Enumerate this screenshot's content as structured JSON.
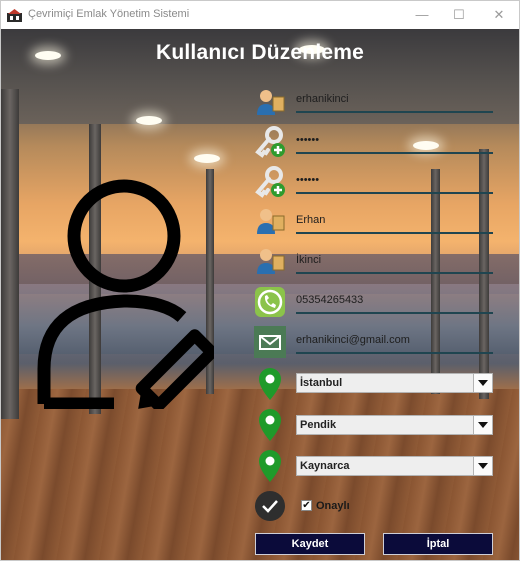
{
  "window": {
    "title": "Çevrimiçi Emlak Yönetim Sistemi",
    "minimize_label": "—",
    "maximize_label": "☐",
    "close_label": "✕"
  },
  "form": {
    "heading": "Kullanıcı Düzenleme",
    "username": "erhanikinci",
    "password": "••••••",
    "password_confirm": "••••••",
    "first_name": "Erhan",
    "last_name": "İkinci",
    "phone": "05354265433",
    "email": "erhanikinci@gmail.com",
    "city": "İstanbul",
    "district": "Pendik",
    "neighborhood": "Kaynarca",
    "approved_label": "Onaylı",
    "approved": true,
    "save_label": "Kaydet",
    "cancel_label": "İptal"
  },
  "icons": {
    "username": "user-icon",
    "password": "key-add-icon",
    "password_confirm": "key-add-icon",
    "first_name": "user-icon",
    "last_name": "user-icon",
    "phone": "phone-icon",
    "email": "envelope-icon",
    "city": "map-pin-icon",
    "district": "map-pin-icon",
    "neighborhood": "map-pin-icon",
    "approved": "checkmark-circle-icon",
    "avatar": "user-edit-icon"
  },
  "colors": {
    "button_bg": "#0b0b3a",
    "field_underline": "#1f4550",
    "pin_green": "#1f9a2a",
    "phone_green": "#8bc34a",
    "mail_green": "#4b7a55"
  }
}
